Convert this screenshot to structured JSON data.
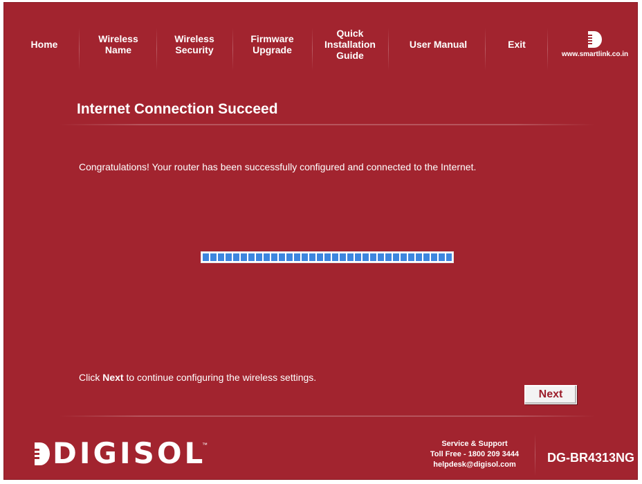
{
  "nav": {
    "items": [
      {
        "label": "Home"
      },
      {
        "label": "Wireless\nName"
      },
      {
        "label": "Wireless\nSecurity"
      },
      {
        "label": "Firmware\nUpgrade"
      },
      {
        "label": "Quick\nInstallation\nGuide"
      },
      {
        "label": "User Manual"
      },
      {
        "label": "Exit"
      }
    ],
    "brand_url": "www.smartlink.co.in"
  },
  "page": {
    "title": "Internet Connection Succeed",
    "message": "Congratulations! Your router has been successfully configured and connected to the Internet.",
    "progress_percent": 100,
    "hint_prefix": "Click ",
    "hint_bold": "Next",
    "hint_suffix": " to continue configuring the wireless settings.",
    "next_label": "Next"
  },
  "footer": {
    "logo_text": "DIGISOL",
    "logo_tm": "™",
    "support_title": "Service & Support",
    "support_phone": "Toll Free - 1800 209 3444",
    "support_email": "helpdesk@digisol.com",
    "model": "DG-BR4313NG"
  },
  "colors": {
    "background": "#a2242f",
    "progress": "#3d86df",
    "button_text": "#9b1d2a"
  }
}
